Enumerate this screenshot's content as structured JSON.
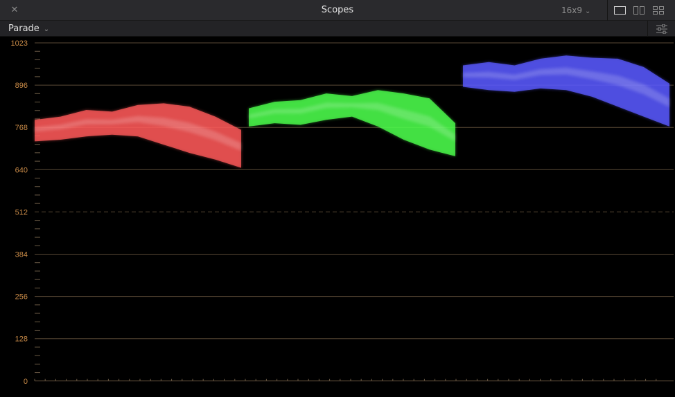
{
  "window": {
    "title": "Scopes",
    "aspect": "16x9",
    "close_glyph": "✕"
  },
  "toolbar": {
    "mode": "Parade"
  },
  "scope": {
    "y_labels": [
      "1023",
      "896",
      "768",
      "640",
      "512",
      "384",
      "256",
      "128",
      "0"
    ],
    "label_color": "#c88a47",
    "channels": [
      {
        "name": "red",
        "color": "#ff5a5a"
      },
      {
        "name": "green",
        "color": "#4dff4d"
      },
      {
        "name": "blue",
        "color": "#5a5aff"
      }
    ]
  }
}
